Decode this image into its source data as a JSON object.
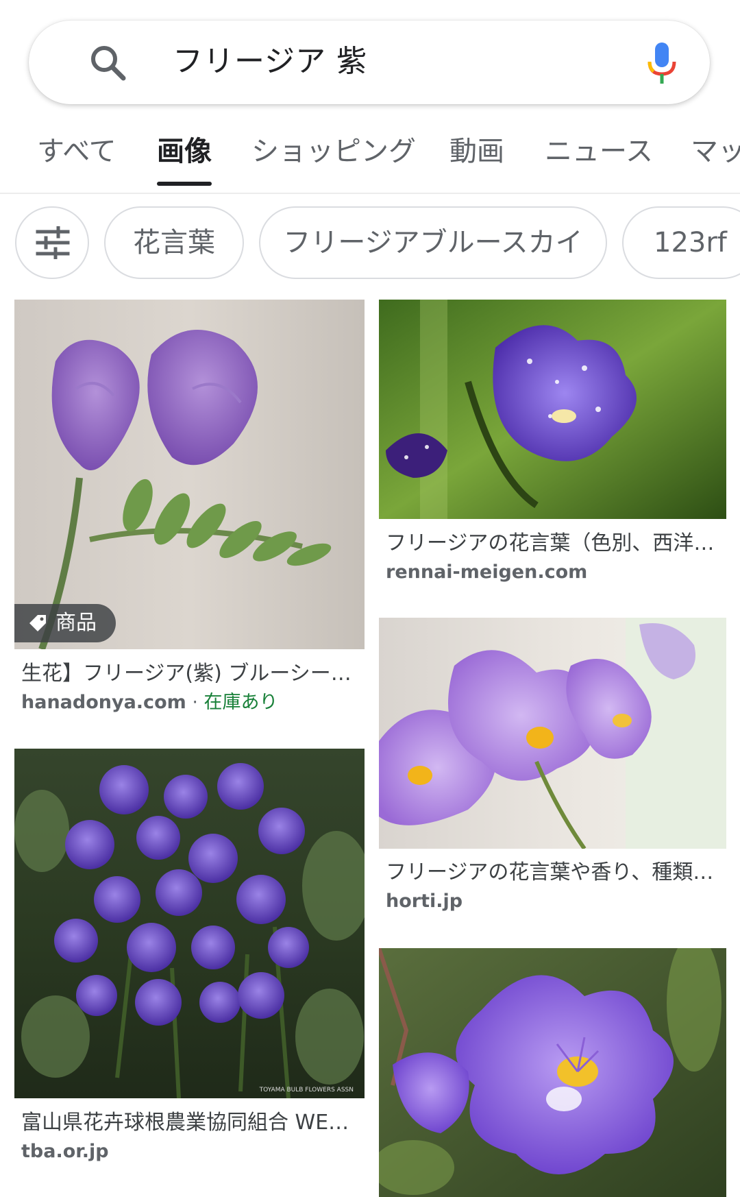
{
  "search": {
    "query": "フリージア 紫"
  },
  "tabs": [
    {
      "label": "すべて",
      "active": false
    },
    {
      "label": "画像",
      "active": true
    },
    {
      "label": "ショッピング",
      "active": false
    },
    {
      "label": "動画",
      "active": false
    },
    {
      "label": "ニュース",
      "active": false
    },
    {
      "label": "マッ",
      "active": false
    }
  ],
  "chips": [
    {
      "label": "花言葉"
    },
    {
      "label": "フリージアブルースカイ"
    },
    {
      "label": "123rf"
    }
  ],
  "results": [
    {
      "title": "生花】フリージア(紫) ブルーシー…",
      "source": "hanadonya.com",
      "separator": " · ",
      "stock": "在庫あり",
      "badge": "商品"
    },
    {
      "title": "フリージアの花言葉（色別、西洋…",
      "source": "rennai-meigen.com"
    },
    {
      "title": "フリージアの花言葉や香り、種類…",
      "source": "horti.jp"
    },
    {
      "title": "富山県花卉球根農業協同組合 WE…",
      "source": "tba.or.jp"
    },
    {
      "title": "",
      "source": ""
    }
  ],
  "colors": {
    "accent": "#202124",
    "stock_green": "#188038",
    "mic_blue": "#4285f4",
    "mic_red": "#ea4335",
    "mic_yellow": "#fbbc04",
    "mic_green": "#34a853"
  }
}
